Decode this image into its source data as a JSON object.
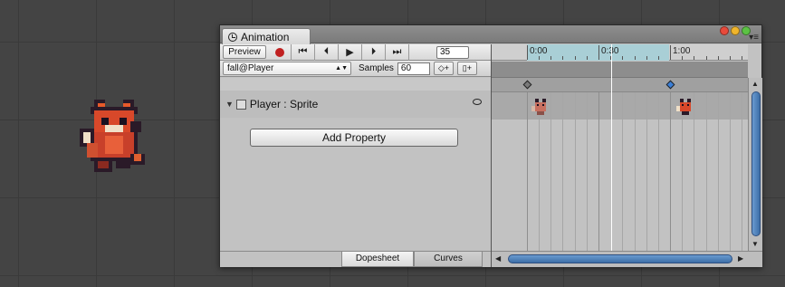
{
  "window": {
    "tab_title": "Animation",
    "traffic_lights": [
      "#e84a3b",
      "#f0b52c",
      "#5cc244"
    ]
  },
  "toolbar": {
    "preview_label": "Preview",
    "record_icon": "record-icon",
    "nav_buttons": [
      {
        "name": "first-key-button",
        "glyph": "⏮"
      },
      {
        "name": "prev-key-button",
        "glyph": "⏴"
      },
      {
        "name": "play-button",
        "glyph": "▶"
      },
      {
        "name": "next-key-button",
        "glyph": "⏵"
      },
      {
        "name": "last-key-button",
        "glyph": "⏭"
      }
    ],
    "frame_value": "35"
  },
  "clip_bar": {
    "clip_name": "fall@Player",
    "samples_label": "Samples",
    "samples_value": "60",
    "add_key_glyph": "◇+",
    "add_event_glyph": "▯+"
  },
  "property": {
    "label": "Player : Sprite"
  },
  "add_property_label": "Add Property",
  "bottom_tabs": {
    "dopesheet": "Dopesheet",
    "curves": "Curves"
  },
  "ruler": {
    "labels": [
      "0:00",
      "0:30",
      "1:00"
    ]
  },
  "colors": {
    "selection_highlight": "#a9cfd6",
    "scrollbar_accent": "#4a7fbe",
    "key_left": "#7a7a7a",
    "key_right": "#3a7fd8"
  }
}
